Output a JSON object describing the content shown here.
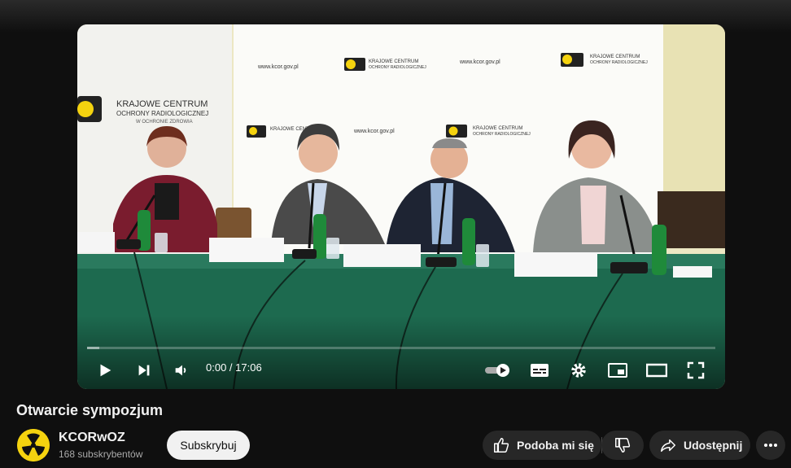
{
  "player": {
    "time_display": "0:00 / 17:06",
    "played_fraction": 0.0,
    "buffered_fraction": 0.02
  },
  "scene": {
    "banner_url": "www.kcor.gov.pl",
    "banner_org_line1": "KRAJOWE CENTRUM",
    "banner_org_line2": "OCHRONY RADIOLOGICZNEJ",
    "banner_org_line3": "W OCHRONIE ZDROWIA"
  },
  "video": {
    "title": "Otwarcie sympozjum"
  },
  "channel": {
    "name": "KCORwOZ",
    "subscribers": "168 subskrybentów",
    "subscribe_label": "Subskrybuj"
  },
  "actions": {
    "like_label": "Podoba mi się",
    "share_label": "Udostępnij"
  },
  "colors": {
    "background": "#0f0f0f",
    "pill": "#272727",
    "brand_yellow": "#f5d30f",
    "table_green": "#1d6a4f"
  },
  "icons": [
    "play-icon",
    "next-icon",
    "volume-icon",
    "autoplay-toggle",
    "subtitles-icon",
    "settings-icon",
    "miniplayer-icon",
    "theater-icon",
    "fullscreen-icon",
    "like-icon",
    "dislike-icon",
    "share-icon",
    "more-icon"
  ]
}
